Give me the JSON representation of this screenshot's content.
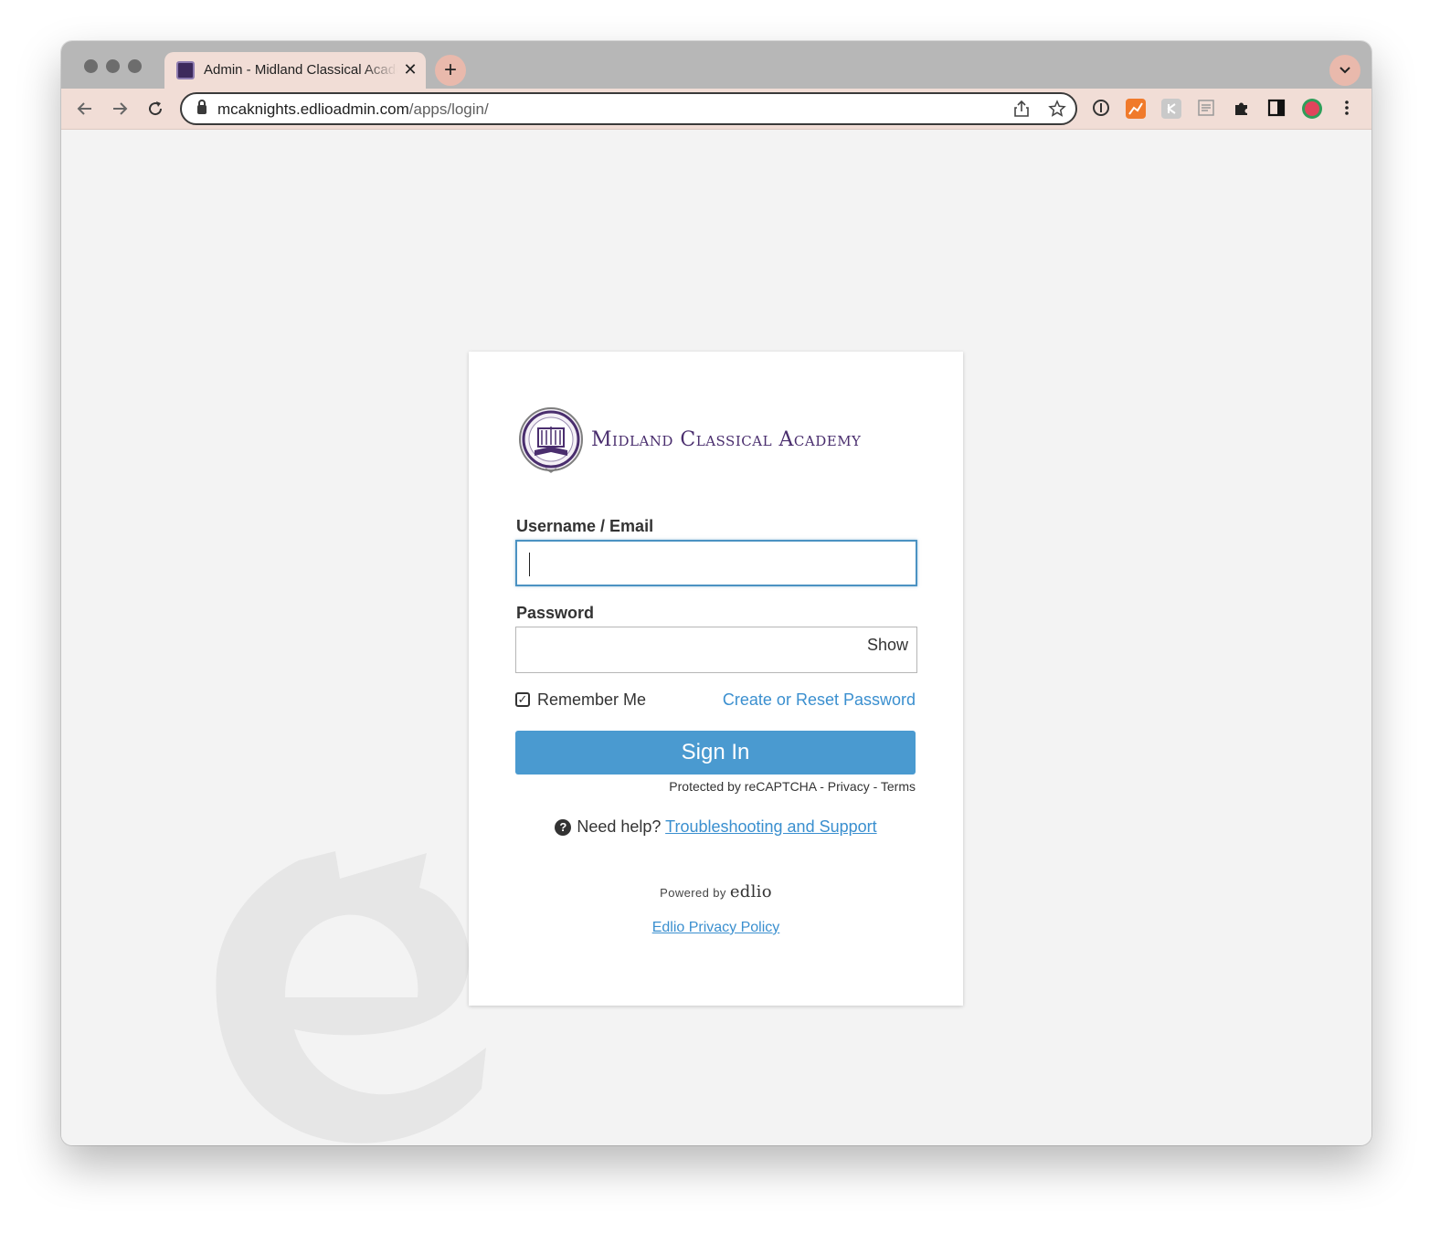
{
  "browser": {
    "tab_title": "Admin - Midland Classical Academy",
    "tab_close": "✕",
    "new_tab": "+",
    "url_host": "mcaknights.edlioadmin.com",
    "url_path": "/apps/login/"
  },
  "logo": {
    "school_name": "Midland Classical Academy"
  },
  "form": {
    "username_label": "Username / Email",
    "username_value": "",
    "password_label": "Password",
    "password_value": "",
    "show_label": "Show",
    "remember_label": "Remember Me",
    "remember_checked": true,
    "checkbox_mark": "✓",
    "reset_link": "Create or Reset Password",
    "signin_label": "Sign In",
    "recaptcha_text": "Protected by reCAPTCHA - Privacy - Terms"
  },
  "help": {
    "icon": "?",
    "prefix": "Need help?",
    "link": "Troubleshooting and Support"
  },
  "footer": {
    "powered_by": "Powered by",
    "brand": "edlio",
    "privacy_link": "Edlio Privacy Policy"
  },
  "colors": {
    "accent": "#4a9ad0",
    "link": "#3a8fcf",
    "school_purple": "#4a2e6e",
    "toolbar": "#f1ddd6"
  }
}
